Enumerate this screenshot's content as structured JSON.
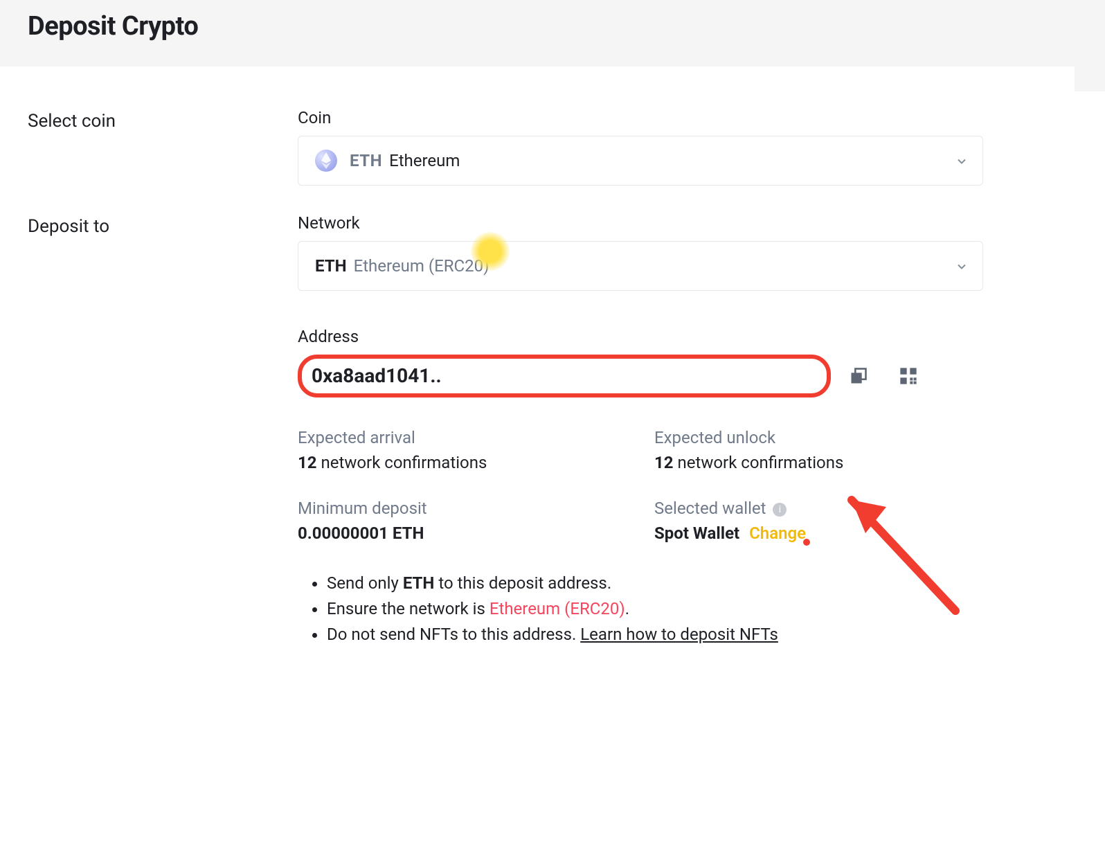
{
  "header": {
    "title": "Deposit Crypto"
  },
  "step1": {
    "label": "Select coin",
    "field_label": "Coin",
    "coin_symbol": "ETH",
    "coin_name": "Ethereum"
  },
  "step2": {
    "label": "Deposit to",
    "network_label": "Network",
    "network_symbol": "ETH",
    "network_name": "Ethereum (ERC20)",
    "address_label": "Address",
    "address_value": "0xa8aad1041..",
    "expected_arrival_label": "Expected arrival",
    "expected_arrival_count": "12",
    "expected_arrival_unit": "network confirmations",
    "expected_unlock_label": "Expected unlock",
    "expected_unlock_count": "12",
    "expected_unlock_unit": "network confirmations",
    "min_deposit_label": "Minimum deposit",
    "min_deposit_value": "0.00000001 ETH",
    "selected_wallet_label": "Selected wallet",
    "selected_wallet_value": "Spot Wallet",
    "change_label": "Change"
  },
  "notes": {
    "n1_pre": "Send only ",
    "n1_bold": "ETH",
    "n1_post": " to this deposit address.",
    "n2_pre": "Ensure the network is ",
    "n2_red": "Ethereum (ERC20)",
    "n2_post": ".",
    "n3_pre": "Do not send NFTs to this address. ",
    "n3_link": "Learn how to deposit NFTs"
  },
  "overlay": {
    "cursor_highlight": true
  }
}
